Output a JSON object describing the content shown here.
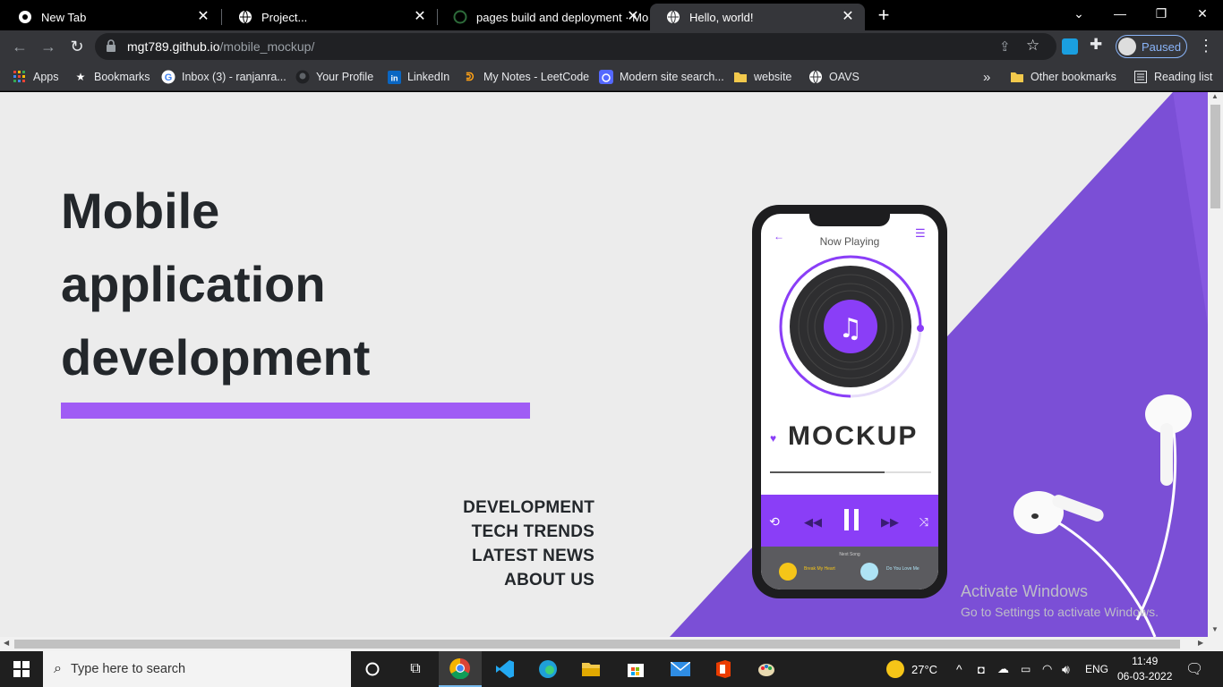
{
  "tabs": [
    {
      "title": "New Tab",
      "icon": "chrome-icon"
    },
    {
      "title": "Project...",
      "icon": "globe-icon"
    },
    {
      "title": "pages build and deployment · Mo",
      "icon": "loading-icon"
    },
    {
      "title": "Hello, world!",
      "icon": "globe-icon",
      "active": true
    }
  ],
  "omnibox": {
    "host": "mgt789.github.io",
    "path": "/mobile_mockup/"
  },
  "profile": {
    "label": "Paused"
  },
  "bookmarks": [
    {
      "label": "Apps",
      "icon": "apps-grid-icon"
    },
    {
      "label": "Bookmarks",
      "icon": "star-icon"
    },
    {
      "label": "Inbox (3) - ranjanra...",
      "icon": "google-icon"
    },
    {
      "label": "Your Profile",
      "icon": "github-icon"
    },
    {
      "label": "LinkedIn",
      "icon": "linkedin-icon"
    },
    {
      "label": "My Notes - LeetCode",
      "icon": "leetcode-icon"
    },
    {
      "label": "Modern site search...",
      "icon": "algolia-icon"
    },
    {
      "label": "website",
      "icon": "folder-icon"
    },
    {
      "label": "OAVS",
      "icon": "globe-icon"
    }
  ],
  "other_bookmarks": "Other bookmarks",
  "reading_list": "Reading list",
  "page": {
    "hero_line1": "Mobile",
    "hero_line2": "application",
    "hero_line3": "development",
    "nav": [
      "DEVELOPMENT",
      "TECH TRENDS",
      "LATEST NEWS",
      "ABOUT US"
    ],
    "accent": "#a05cf5",
    "phone": {
      "now_playing": "Now Playing",
      "mockup": "MOCKUP",
      "next_song_label": "Next Song",
      "song1": "Break My Heart",
      "song2": "Do You Love Me"
    }
  },
  "watermark": {
    "line1": "Activate Windows",
    "line2": "Go to Settings to activate Windows."
  },
  "taskbar": {
    "search_placeholder": "Type here to search",
    "weather": "27°C",
    "lang": "ENG",
    "time": "11:49",
    "date": "06-03-2022"
  }
}
